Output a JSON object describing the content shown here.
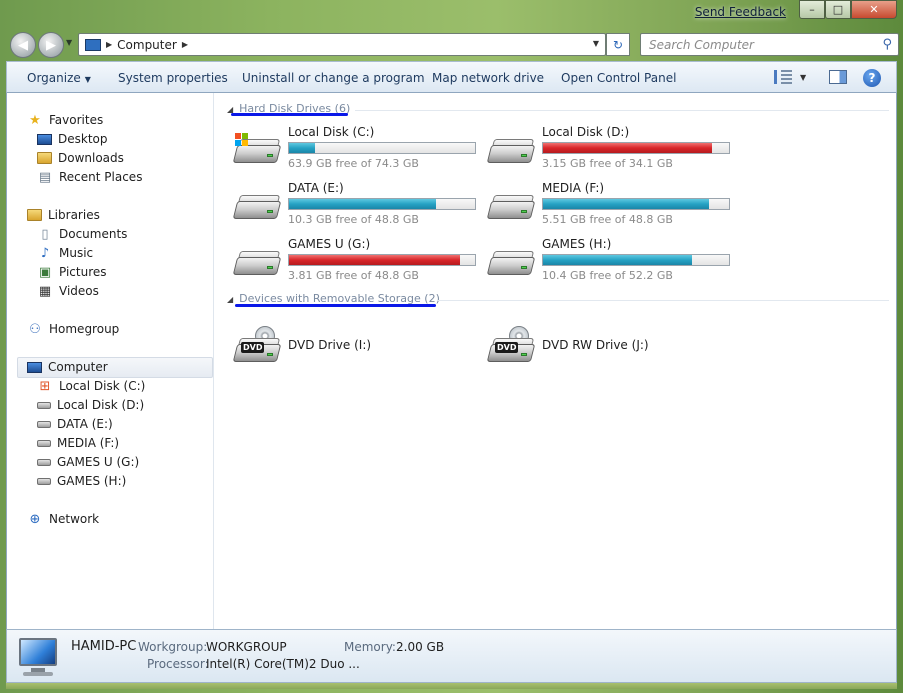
{
  "title_bar": {
    "feedback": "Send Feedback",
    "buttons": [
      "–",
      "□",
      "✕"
    ]
  },
  "nav": {
    "address_location": "Computer",
    "search_placeholder": "Search Computer"
  },
  "command_bar": {
    "items": [
      "Organize",
      "System properties",
      "Uninstall or change a program",
      "Map network drive",
      "Open Control Panel"
    ]
  },
  "sidebar": {
    "favorites": {
      "label": "Favorites",
      "items": [
        "Desktop",
        "Downloads",
        "Recent Places"
      ]
    },
    "libraries": {
      "label": "Libraries",
      "items": [
        "Documents",
        "Music",
        "Pictures",
        "Videos"
      ]
    },
    "homegroup": "Homegroup",
    "computer": {
      "label": "Computer",
      "items": [
        "Local Disk (C:)",
        "Local Disk (D:)",
        "DATA (E:)",
        "MEDIA (F:)",
        "GAMES U (G:)",
        "GAMES (H:)"
      ]
    },
    "network": "Network"
  },
  "groups": {
    "hdd": {
      "title": "Hard Disk Drives",
      "count": "(6)"
    },
    "removable": {
      "title": "Devices with Removable Storage",
      "count": "(2)"
    }
  },
  "drives": [
    {
      "name": "Local Disk (C:)",
      "free": "63.9 GB free of 74.3 GB",
      "used_fraction": 0.14,
      "status": "blue",
      "system": true
    },
    {
      "name": "Local Disk (D:)",
      "free": "3.15 GB free of 34.1 GB",
      "used_fraction": 0.91,
      "status": "red",
      "system": false
    },
    {
      "name": "DATA (E:)",
      "free": "10.3 GB free of 48.8 GB",
      "used_fraction": 0.79,
      "status": "blue",
      "system": false
    },
    {
      "name": "MEDIA (F:)",
      "free": "5.51 GB free of 48.8 GB",
      "used_fraction": 0.89,
      "status": "blue",
      "system": false
    },
    {
      "name": "GAMES U (G:)",
      "free": "3.81 GB free of 48.8 GB",
      "used_fraction": 0.92,
      "status": "red",
      "system": false
    },
    {
      "name": "GAMES (H:)",
      "free": "10.4 GB free of 52.2 GB",
      "used_fraction": 0.8,
      "status": "blue",
      "system": false
    }
  ],
  "removable": [
    {
      "name": "DVD Drive (I:)",
      "badge": "DVD"
    },
    {
      "name": "DVD RW Drive (J:)",
      "badge": "DVD"
    }
  ],
  "details": {
    "pc_name": "HAMID-PC",
    "workgroup_label": "Workgroup:",
    "workgroup_value": "WORKGROUP",
    "memory_label": "Memory:",
    "memory_value": "2.00 GB",
    "processor_label": "Processor:",
    "processor_value": "Intel(R) Core(TM)2 Duo ..."
  },
  "colors": {
    "bar_blue": "#26a2c4",
    "bar_red": "#d8262a",
    "underline": "#0a18e8"
  }
}
